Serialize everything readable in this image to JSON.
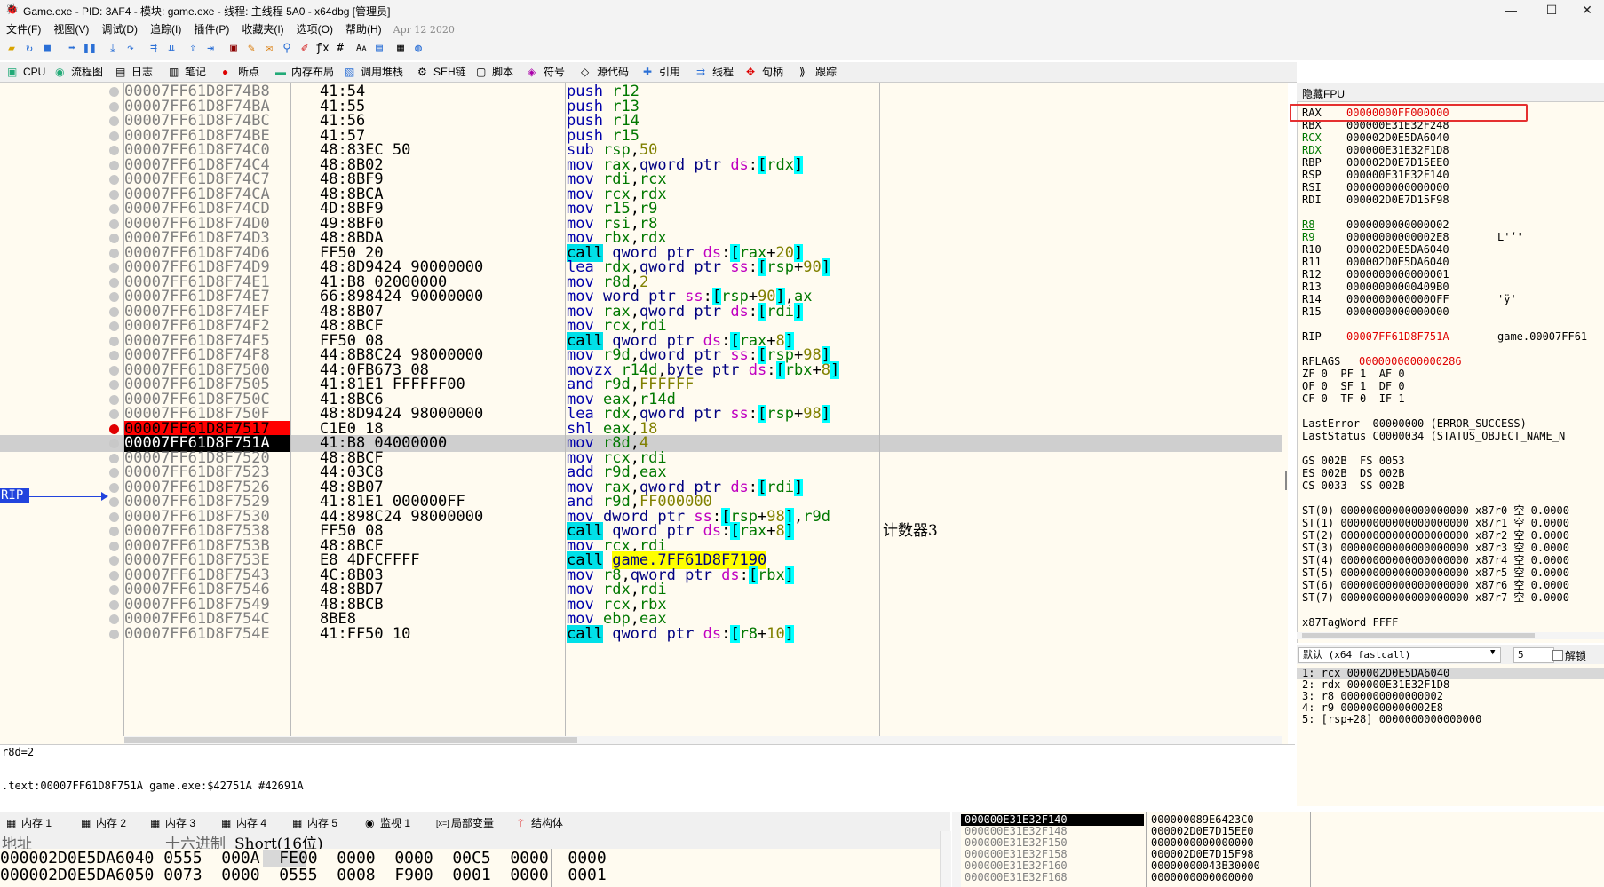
{
  "window": {
    "title": "Game.exe - PID: 3AF4 - 模块: game.exe - 线程: 主线程 5A0 - x64dbg [管理员]",
    "icon": "bug-icon",
    "min": "—",
    "max": "☐",
    "close": "✕"
  },
  "menu": {
    "items": [
      "文件(F)",
      "视图(V)",
      "调试(D)",
      "追踪(I)",
      "插件(P)",
      "收藏夹(I)",
      "选项(O)",
      "帮助(H)"
    ],
    "date": "Apr 12 2020"
  },
  "tabs": [
    {
      "label": "CPU",
      "icon": "cpu-icon"
    },
    {
      "label": "流程图",
      "icon": "graph-icon"
    },
    {
      "label": "日志",
      "icon": "log-icon"
    },
    {
      "label": "笔记",
      "icon": "notes-icon"
    },
    {
      "label": "断点",
      "icon": "breakpoint-icon"
    },
    {
      "label": "内存布局",
      "icon": "memory-map-icon"
    },
    {
      "label": "调用堆栈",
      "icon": "callstack-icon"
    },
    {
      "label": "SEH链",
      "icon": "seh-icon"
    },
    {
      "label": "脚本",
      "icon": "script-icon"
    },
    {
      "label": "符号",
      "icon": "symbol-icon"
    },
    {
      "label": "源代码",
      "icon": "source-icon"
    },
    {
      "label": "引用",
      "icon": "references-icon"
    },
    {
      "label": "线程",
      "icon": "threads-icon"
    },
    {
      "label": "句柄",
      "icon": "handles-icon"
    },
    {
      "label": "跟踪",
      "icon": "trace-icon"
    }
  ],
  "disasm": {
    "rip_label": "RIP",
    "rows": [
      {
        "addr": "00007FF61D8F74B8",
        "bytes": "41:54",
        "ins": "push r12"
      },
      {
        "addr": "00007FF61D8F74BA",
        "bytes": "41:55",
        "ins": "push r13"
      },
      {
        "addr": "00007FF61D8F74BC",
        "bytes": "41:56",
        "ins": "push r14"
      },
      {
        "addr": "00007FF61D8F74BE",
        "bytes": "41:57",
        "ins": "push r15"
      },
      {
        "addr": "00007FF61D8F74C0",
        "bytes": "48:83EC 50",
        "ins": "sub rsp,50"
      },
      {
        "addr": "00007FF61D8F74C4",
        "bytes": "48:8B02",
        "ins": "mov rax,qword ptr ds:[rdx]"
      },
      {
        "addr": "00007FF61D8F74C7",
        "bytes": "48:8BF9",
        "ins": "mov rdi,rcx"
      },
      {
        "addr": "00007FF61D8F74CA",
        "bytes": "48:8BCA",
        "ins": "mov rcx,rdx"
      },
      {
        "addr": "00007FF61D8F74CD",
        "bytes": "4D:8BF9",
        "ins": "mov r15,r9"
      },
      {
        "addr": "00007FF61D8F74D0",
        "bytes": "49:8BF0",
        "ins": "mov rsi,r8"
      },
      {
        "addr": "00007FF61D8F74D3",
        "bytes": "48:8BDA",
        "ins": "mov rbx,rdx"
      },
      {
        "addr": "00007FF61D8F74D6",
        "bytes": "FF50 20",
        "ins": "call qword ptr ds:[rax+20]"
      },
      {
        "addr": "00007FF61D8F74D9",
        "bytes": "48:8D9424 90000000",
        "ins": "lea rdx,qword ptr ss:[rsp+90]"
      },
      {
        "addr": "00007FF61D8F74E1",
        "bytes": "41:B8 02000000",
        "ins": "mov r8d,2"
      },
      {
        "addr": "00007FF61D8F74E7",
        "bytes": "66:898424 90000000",
        "ins": "mov word ptr ss:[rsp+90],ax"
      },
      {
        "addr": "00007FF61D8F74EF",
        "bytes": "48:8B07",
        "ins": "mov rax,qword ptr ds:[rdi]"
      },
      {
        "addr": "00007FF61D8F74F2",
        "bytes": "48:8BCF",
        "ins": "mov rcx,rdi"
      },
      {
        "addr": "00007FF61D8F74F5",
        "bytes": "FF50 08",
        "ins": "call qword ptr ds:[rax+8]"
      },
      {
        "addr": "00007FF61D8F74F8",
        "bytes": "44:8B8C24 98000000",
        "ins": "mov r9d,dword ptr ss:[rsp+98]"
      },
      {
        "addr": "00007FF61D8F7500",
        "bytes": "44:0FB673 08",
        "ins": "movzx r14d,byte ptr ds:[rbx+8]"
      },
      {
        "addr": "00007FF61D8F7505",
        "bytes": "41:81E1 FFFFFF00",
        "ins": "and r9d,FFFFFF"
      },
      {
        "addr": "00007FF61D8F750C",
        "bytes": "41:8BC6",
        "ins": "mov eax,r14d"
      },
      {
        "addr": "00007FF61D8F750F",
        "bytes": "48:8D9424 98000000",
        "ins": "lea rdx,qword ptr ss:[rsp+98]"
      },
      {
        "addr": "00007FF61D8F7517",
        "bytes": "C1E0 18",
        "ins": "shl eax,18"
      },
      {
        "addr": "00007FF61D8F751A",
        "bytes": "41:B8 04000000",
        "ins": "mov r8d,4"
      },
      {
        "addr": "00007FF61D8F7520",
        "bytes": "48:8BCF",
        "ins": "mov rcx,rdi"
      },
      {
        "addr": "00007FF61D8F7523",
        "bytes": "44:03C8",
        "ins": "add r9d,eax"
      },
      {
        "addr": "00007FF61D8F7526",
        "bytes": "48:8B07",
        "ins": "mov rax,qword ptr ds:[rdi]"
      },
      {
        "addr": "00007FF61D8F7529",
        "bytes": "41:81E1 000000FF",
        "ins": "and r9d,FF000000"
      },
      {
        "addr": "00007FF61D8F7530",
        "bytes": "44:898C24 98000000",
        "ins": "mov dword ptr ss:[rsp+98],r9d"
      },
      {
        "addr": "00007FF61D8F7538",
        "bytes": "FF50 08",
        "ins": "call qword ptr ds:[rax+8]",
        "cmt": "计数器3"
      },
      {
        "addr": "00007FF61D8F753B",
        "bytes": "48:8BCF",
        "ins": "mov rcx,rdi"
      },
      {
        "addr": "00007FF61D8F753E",
        "bytes": "E8 4DFCFFFF",
        "ins": "call game.7FF61D8F7190"
      },
      {
        "addr": "00007FF61D8F7543",
        "bytes": "4C:8B03",
        "ins": "mov r8,qword ptr ds:[rbx]"
      },
      {
        "addr": "00007FF61D8F7546",
        "bytes": "48:8BD7",
        "ins": "mov rdx,rdi"
      },
      {
        "addr": "00007FF61D8F7549",
        "bytes": "48:8BCB",
        "ins": "mov rcx,rbx"
      },
      {
        "addr": "00007FF61D8F754C",
        "bytes": "8BE8",
        "ins": "mov ebp,eax"
      },
      {
        "addr": "00007FF61D8F754E",
        "bytes": "41:FF50 10",
        "ins": "call qword ptr ds:[r8+10]"
      }
    ]
  },
  "info": {
    "line1": "r8d=2",
    "line2": ".text:00007FF61D8F751A game.exe:$42751A #42691A"
  },
  "registers": {
    "header": "隐藏FPU",
    "gp": [
      {
        "name": "RAX",
        "value": "00000000FF000000"
      },
      {
        "name": "RBX",
        "value": "000000E31E32F248"
      },
      {
        "name": "RCX",
        "value": "000002D0E5DA6040"
      },
      {
        "name": "RDX",
        "value": "000000E31E32F1D8"
      },
      {
        "name": "RBP",
        "value": "000002D0E7D15EE0"
      },
      {
        "name": "RSP",
        "value": "000000E31E32F140"
      },
      {
        "name": "RSI",
        "value": "0000000000000000"
      },
      {
        "name": "RDI",
        "value": "000002D0E7D15F98"
      }
    ],
    "ext": [
      {
        "name": "R8",
        "value": "0000000000000002",
        "extra": ""
      },
      {
        "name": "R9",
        "value": "00000000000002E8",
        "extra": "L'ʻ'"
      },
      {
        "name": "R10",
        "value": "000002D0E5DA6040",
        "extra": ""
      },
      {
        "name": "R11",
        "value": "000002D0E5DA6040",
        "extra": ""
      },
      {
        "name": "R12",
        "value": "0000000000000001",
        "extra": ""
      },
      {
        "name": "R13",
        "value": "00000000000409B0",
        "extra": ""
      },
      {
        "name": "R14",
        "value": "00000000000000FF",
        "extra": "'ÿ'"
      },
      {
        "name": "R15",
        "value": "0000000000000000",
        "extra": ""
      }
    ],
    "rip": {
      "name": "RIP",
      "value": "00007FF61D8F751A",
      "extra": "game.00007FF61"
    },
    "rflags": {
      "name": "RFLAGS",
      "value": "0000000000000286"
    },
    "flags": [
      "ZF 0  PF 1  AF 0",
      "OF 0  SF 1  DF 0",
      "CF 0  TF 0  IF 1"
    ],
    "last_error": "LastError  00000000 (ERROR_SUCCESS)",
    "last_status": "LastStatus C0000034 (STATUS_OBJECT_NAME_N",
    "segs": [
      "GS 002B  FS 0053",
      "ES 002B  DS 002B",
      "CS 0033  SS 002B"
    ],
    "st": [
      "ST(0) 00000000000000000000 x87r0 空 0.0000",
      "ST(1) 00000000000000000000 x87r1 空 0.0000",
      "ST(2) 00000000000000000000 x87r2 空 0.0000",
      "ST(3) 00000000000000000000 x87r3 空 0.0000",
      "ST(4) 00000000000000000000 x87r4 空 0.0000",
      "ST(5) 00000000000000000000 x87r5 空 0.0000",
      "ST(6) 00000000000000000000 x87r6 空 0.0000",
      "ST(7) 00000000000000000000 x87r7 空 0.0000"
    ],
    "tagword": "x87TagWord FFFF"
  },
  "callconv": {
    "select": "默认 (x64 fastcall)",
    "count": "5",
    "unlock": "解锁",
    "args": [
      "1: rcx 000002D0E5DA6040",
      "2: rdx 000000E31E32F1D8",
      "3: r8 0000000000000002",
      "4: r9 00000000000002E8",
      "5: [rsp+28] 0000000000000000"
    ]
  },
  "dumptabs": [
    {
      "label": "内存 1",
      "icon": "memory-icon"
    },
    {
      "label": "内存 2",
      "icon": "memory-icon"
    },
    {
      "label": "内存 3",
      "icon": "memory-icon"
    },
    {
      "label": "内存 4",
      "icon": "memory-icon"
    },
    {
      "label": "内存 5",
      "icon": "memory-icon"
    },
    {
      "label": "监视 1",
      "icon": "watch-icon"
    },
    {
      "label": "局部变量",
      "icon": "locals-icon"
    },
    {
      "label": "结构体",
      "icon": "struct-icon"
    }
  ],
  "dump": {
    "col_addr": "地址",
    "col_hex": "十六进制",
    "col_short": "Short(16位)",
    "rows": [
      "000002D0E5DA6040 0555  000A  FE00  0000  0000  00C5  0000  0000",
      "000002D0E5DA6050 0073  0000  0555  0008  F900  0001  0000  0001"
    ]
  },
  "stack": {
    "rows": [
      {
        "addr": "000000E31E32F140",
        "val": "000000089E6423C0"
      },
      {
        "addr": "000000E31E32F148",
        "val": "000002D0E7D15EE0"
      },
      {
        "addr": "000000E31E32F150",
        "val": "0000000000000000"
      },
      {
        "addr": "000000E31E32F158",
        "val": "000002D0E7D15F98"
      },
      {
        "addr": "000000E31E32F160",
        "val": "00000000043B30000"
      },
      {
        "addr": "000000E31E32F168",
        "val": "0000000000000000"
      }
    ]
  }
}
